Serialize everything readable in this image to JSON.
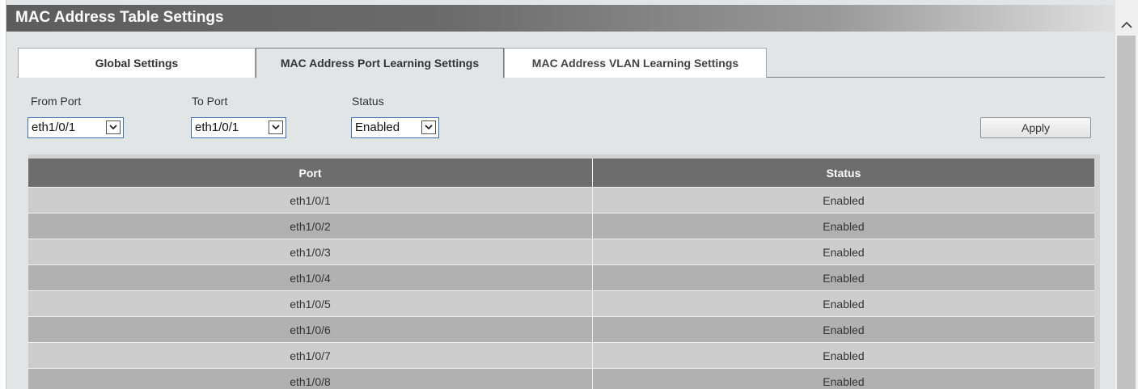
{
  "header": {
    "title": "MAC Address Table Settings"
  },
  "tabs": [
    {
      "label": "Global Settings",
      "active": false
    },
    {
      "label": "MAC Address Port Learning Settings",
      "active": true
    },
    {
      "label": "MAC Address VLAN Learning Settings",
      "active": false
    }
  ],
  "form": {
    "from_port": {
      "label": "From Port",
      "value": "eth1/0/1"
    },
    "to_port": {
      "label": "To Port",
      "value": "eth1/0/1"
    },
    "status": {
      "label": "Status",
      "value": "Enabled"
    },
    "apply_label": "Apply"
  },
  "table": {
    "columns": [
      "Port",
      "Status"
    ],
    "rows": [
      {
        "port": "eth1/0/1",
        "status": "Enabled"
      },
      {
        "port": "eth1/0/2",
        "status": "Enabled"
      },
      {
        "port": "eth1/0/3",
        "status": "Enabled"
      },
      {
        "port": "eth1/0/4",
        "status": "Enabled"
      },
      {
        "port": "eth1/0/5",
        "status": "Enabled"
      },
      {
        "port": "eth1/0/6",
        "status": "Enabled"
      },
      {
        "port": "eth1/0/7",
        "status": "Enabled"
      },
      {
        "port": "eth1/0/8",
        "status": "Enabled"
      }
    ]
  },
  "icons": {
    "dropdown": "chevron-down-icon",
    "scroll_up": "chevron-up-icon"
  },
  "colors": {
    "title_bar": "#5d5d5d",
    "table_header": "#6d6d6d",
    "row_light": "#cdcdcd",
    "row_dark": "#b1b1b1",
    "panel": "#e1e5e5"
  }
}
